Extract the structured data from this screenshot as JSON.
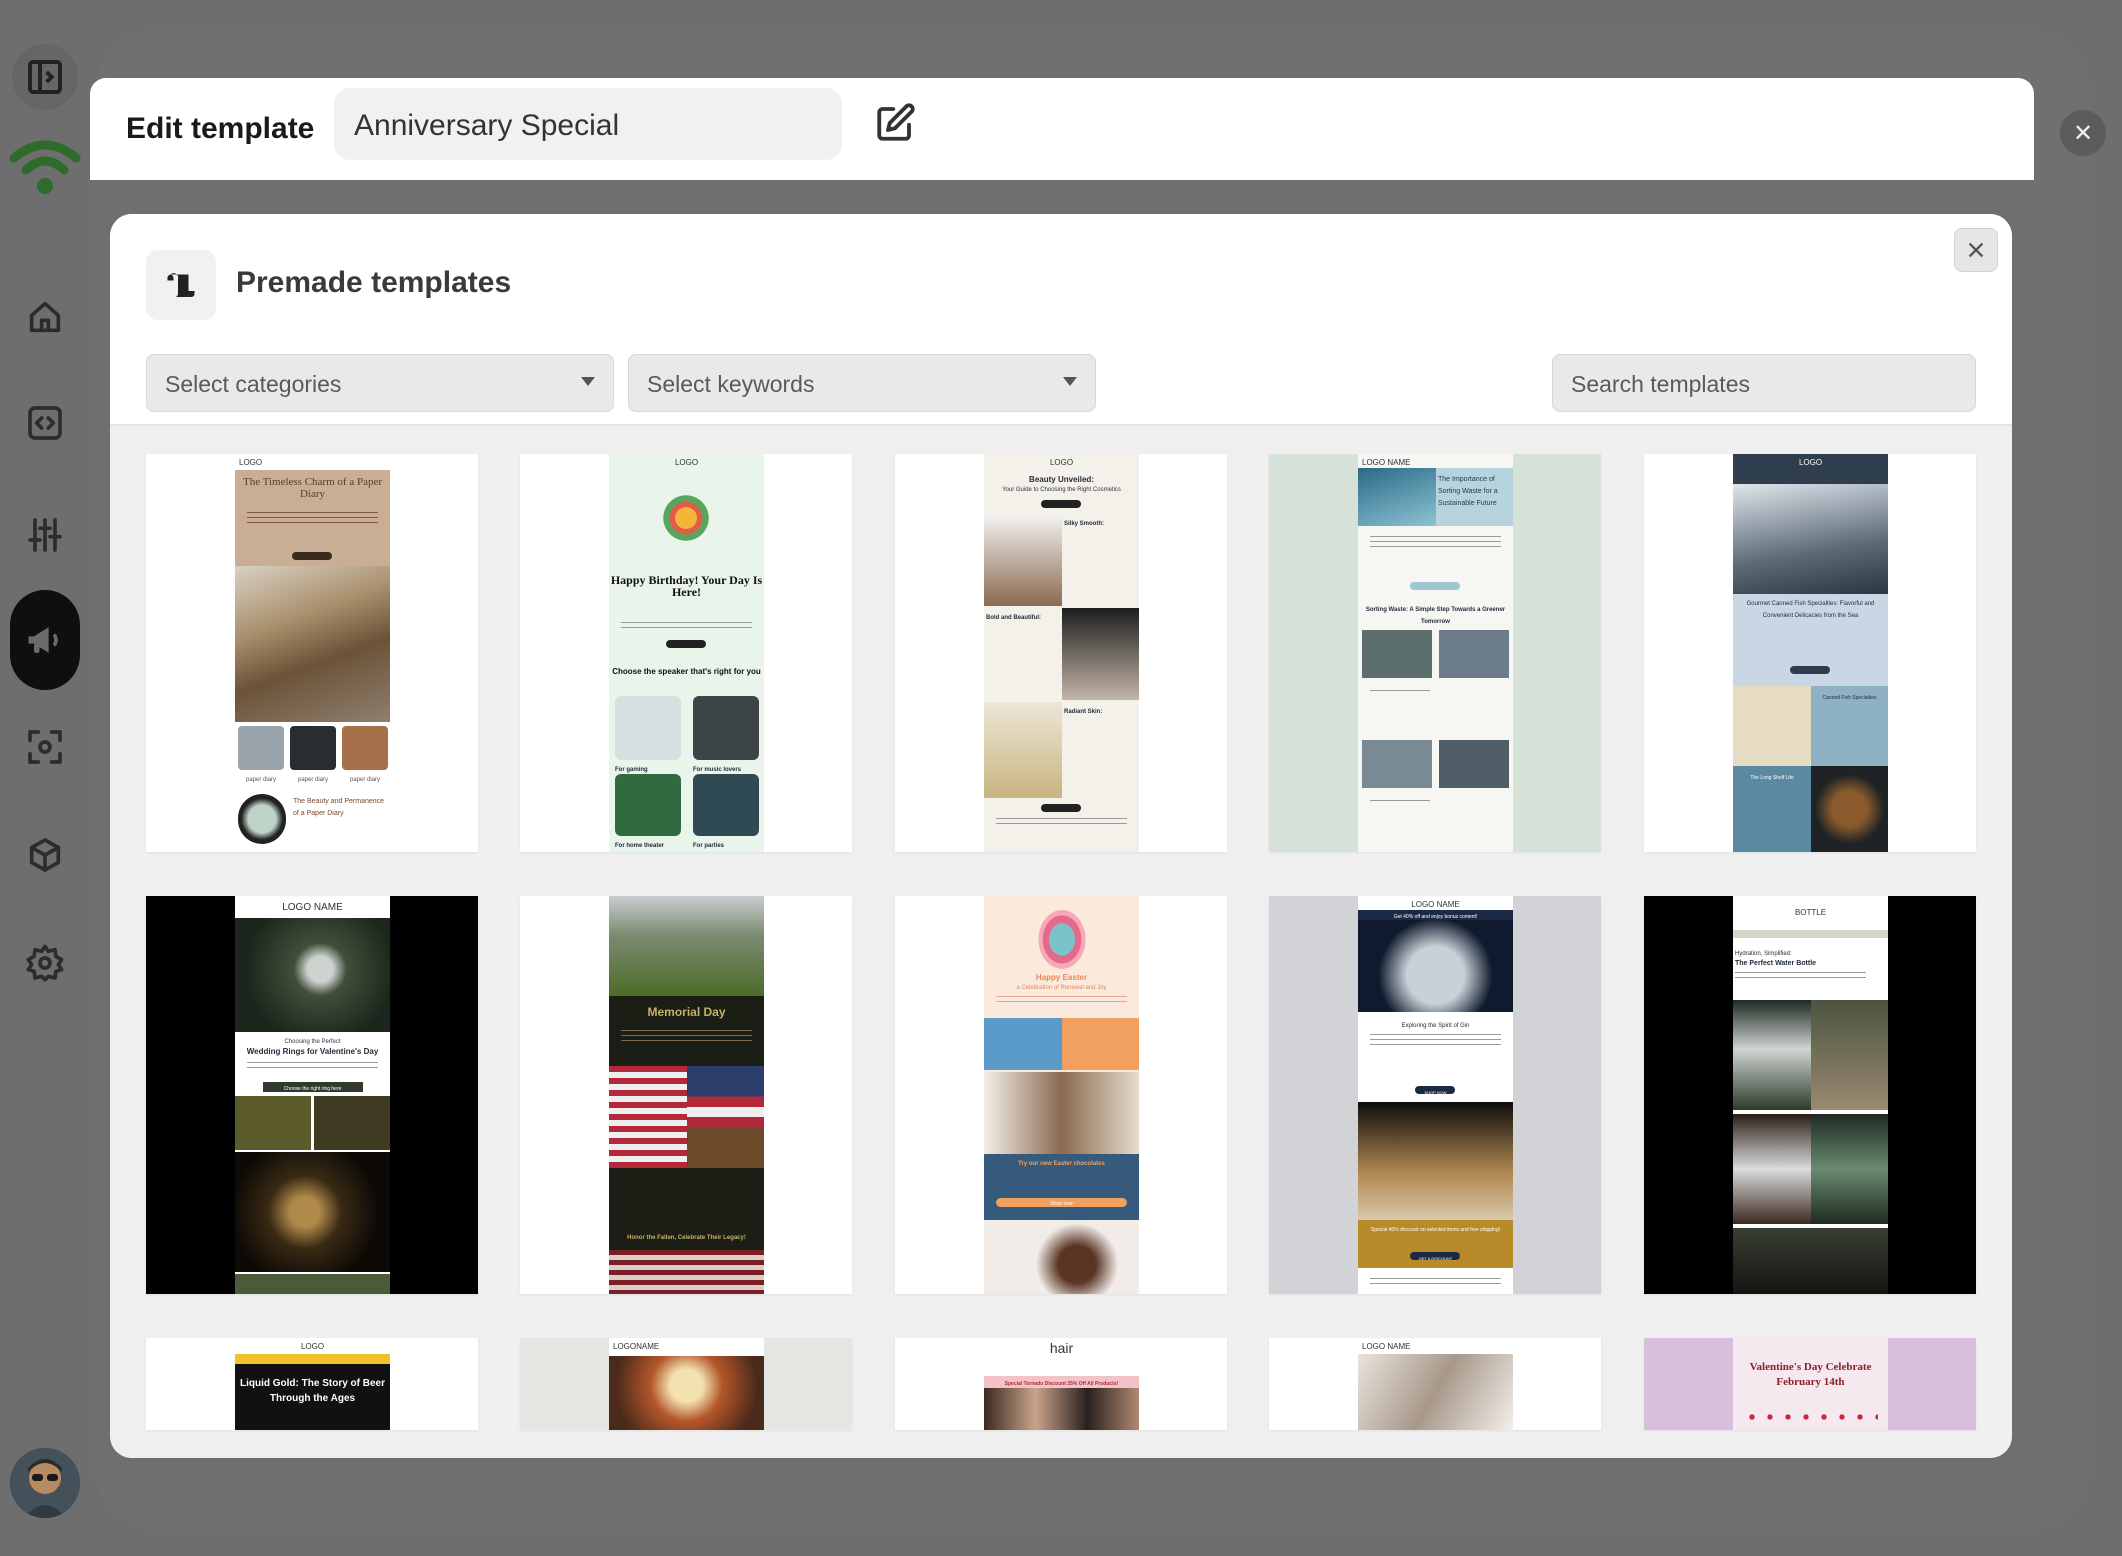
{
  "edit_template": {
    "title": "Edit template",
    "template_name": "Anniversary Special"
  },
  "modal": {
    "title": "Premade templates",
    "categories_placeholder": "Select categories",
    "keywords_placeholder": "Select keywords",
    "search_placeholder": "Search templates"
  },
  "templates": [
    {
      "logo": "LOGO",
      "headline": "The Timeless Charm of a Paper Diary",
      "captions": [
        "paper diary",
        "paper diary",
        "paper diary"
      ],
      "footer": "The Beauty and Permanence of a Paper Diary"
    },
    {
      "logo": "LOGO",
      "headline": "Happy Birthday! Your Day Is Here!",
      "subhead": "Your Day Is Here!",
      "section": "Choose the speaker that's right for you",
      "captions": [
        "For gaming",
        "For music lovers",
        "For home theater",
        "For parties"
      ]
    },
    {
      "logo": "LOGO",
      "headline": "Beauty Unveiled:",
      "subhead": "Your Guide to Choosing the Right Cosmetics",
      "section1": "Silky Smooth:",
      "section2": "Bold and Beautiful:",
      "section3": "Radiant Skin:"
    },
    {
      "logo": "LOGO NAME",
      "headline": "The Importance of Sorting Waste for a Sustainable Future",
      "section": "Sorting Waste: A Simple Step Towards a Greener Tomorrow"
    },
    {
      "logo": "LOGO",
      "headline": "Gourmet Canned Fish Specialties: Flavorful and Convenient Delicacies from the Sea",
      "section": "Canned Fish Specialties",
      "section2": "The Long Shelf Life"
    },
    {
      "logo": "LOGO NAME",
      "headline": "Wedding Rings for Valentine's Day",
      "kicker": "Choosing the Perfect",
      "cta": "Choose the right ring here"
    },
    {
      "headline": "Memorial Day",
      "footer": "Honor the Fallen, Celebrate Their Legacy!"
    },
    {
      "headline": "Happy Easter",
      "subhead": "a Celebration of Renewal and Joy",
      "section": "Try our new Easter chocolates",
      "cta": "Shop now"
    },
    {
      "logo": "LOGO NAME",
      "banner": "Get 40% off and enjoy bonus content!",
      "headline": "Exploring the Spirit of Gin",
      "cta": "SHOP NOW",
      "promo": "Special 40% discount on selected items and free shipping!",
      "cta2": "GET A DISCOUNT"
    },
    {
      "logo": "BOTTLE",
      "kicker": "Hydration, Simplified:",
      "headline": "The Perfect Water Bottle"
    },
    {
      "logo": "LOGO",
      "headline": "Liquid Gold: The Story of Beer Through the Ages"
    },
    {
      "logo": "LOGONAME"
    },
    {
      "logo": "hair",
      "banner": "Special Tornado Discount 25% Off All Products!"
    },
    {
      "logo": "LOGO NAME"
    },
    {
      "headline": "Valentine's Day Celebrate February 14th"
    }
  ],
  "colors": {
    "brand_green": "#2f6b2a",
    "overlay_grey": "#6e6e6e",
    "grid_bg": "#efefef"
  },
  "icons": [
    "sidebar-toggle-icon",
    "brand-wifi-icon",
    "home-icon",
    "code-icon",
    "sliders-icon",
    "megaphone-icon",
    "scan-icon",
    "cube-icon",
    "settings-icon",
    "close-icon",
    "pencil-icon",
    "scroll-icon"
  ]
}
